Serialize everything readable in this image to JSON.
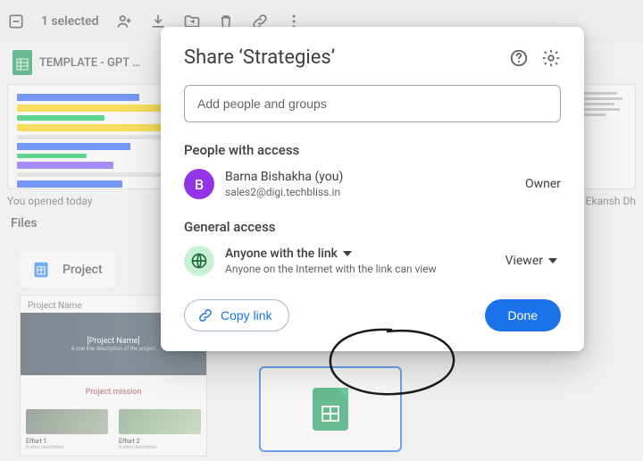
{
  "toolbar": {
    "selected_text": "1 selected"
  },
  "background": {
    "template_title": "TEMPLATE - GPT …",
    "opened_caption": "You opened today",
    "right_caption": "by Ekansh Dh",
    "files_label": "Files",
    "folder_name": "Project",
    "proj_header": "Project Name",
    "proj_name": "[Project Name]",
    "proj_desc": "A one line description of the project",
    "proj_mission": "Project mission",
    "eff1": "Effort 1",
    "eff2": "Effort 2",
    "eff_desc": "A short description"
  },
  "dialog": {
    "title": "Share ‘Strategies’",
    "input_placeholder": "Add people and groups",
    "people_section": "People with access",
    "person": {
      "initial": "B",
      "name": "Barna Bishakha (you)",
      "email": "sales2@digi.techbliss.in",
      "role": "Owner"
    },
    "general_section": "General access",
    "access": {
      "type": "Anyone with the link",
      "desc": "Anyone on the Internet with the link can view",
      "role": "Viewer"
    },
    "copy_link": "Copy link",
    "done": "Done"
  }
}
